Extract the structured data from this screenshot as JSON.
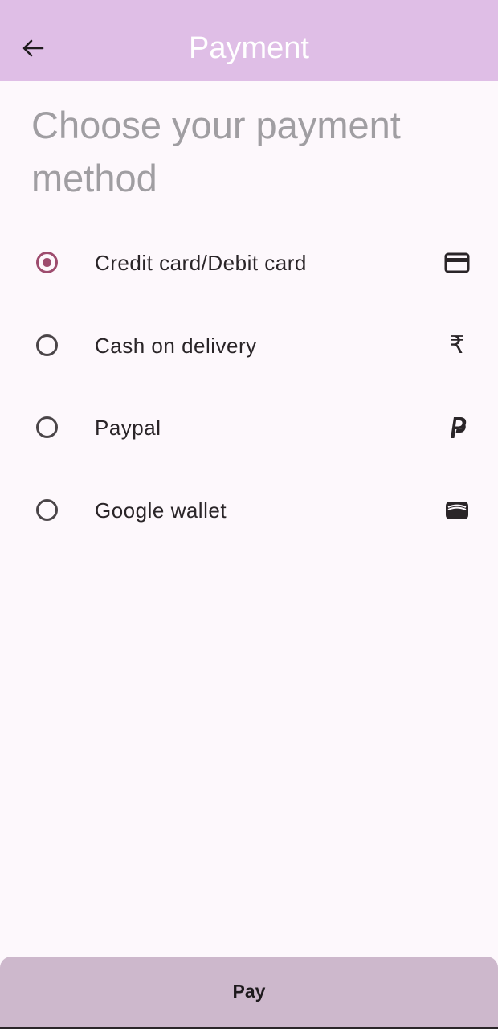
{
  "appbar": {
    "title": "Payment",
    "back_icon": "arrow-left-icon",
    "background": "#dfbee6"
  },
  "heading": "Choose your payment method",
  "accent_color": "#9e4c6e",
  "payment_options": [
    {
      "label": "Credit card/Debit card",
      "icon": "credit-card-icon",
      "selected": true
    },
    {
      "label": "Cash on delivery",
      "icon": "rupee-icon",
      "glyph": "₹",
      "selected": false
    },
    {
      "label": "Paypal",
      "icon": "paypal-icon",
      "selected": false
    },
    {
      "label": "Google wallet",
      "icon": "wallet-icon",
      "selected": false
    }
  ],
  "pay_button": {
    "label": "Pay",
    "background": "#cdb8cc"
  }
}
